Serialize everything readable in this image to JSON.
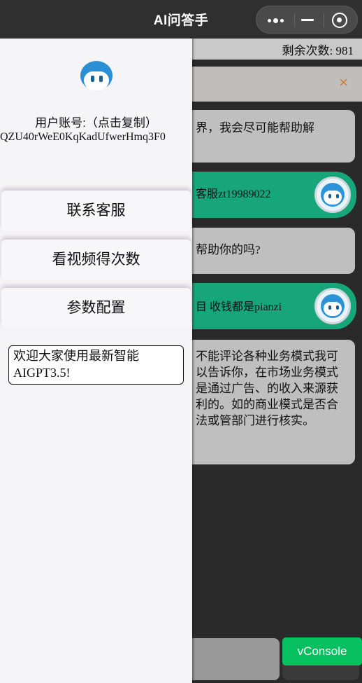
{
  "topbar": {
    "title": "AI问答手"
  },
  "chat": {
    "remaining_label": "剩余次数: 981",
    "notice_close": "×",
    "messages": [
      {
        "role": "bot",
        "text": "界，我会尽可能帮助解"
      },
      {
        "role": "user",
        "text": "客服zt19989022"
      },
      {
        "role": "bot",
        "text": "帮助你的吗?"
      },
      {
        "role": "user",
        "text": "目 收钱都是pianzi"
      },
      {
        "role": "bot",
        "text": "不能评论各种业务模式我可以告诉你，在市场业务模式是通过广告、的收入来源获利的。如的商业模式是否合法或管部门进行核实。"
      }
    ]
  },
  "drawer": {
    "account_label": "用户账号:（点击复制）",
    "account_id": "QZU40rWeE0KqKadUfwerHmq3F0",
    "menu": [
      {
        "label": "联系客服"
      },
      {
        "label": "看视频得次数"
      },
      {
        "label": "参数配置"
      }
    ],
    "welcome": "欢迎大家使用最新智能AIGPT3.5!"
  },
  "vconsole": {
    "label": "vConsole"
  },
  "colors": {
    "vconsole": "#07c160",
    "user_bubble": "#17a67a",
    "avatar": "#2b8fd6"
  }
}
